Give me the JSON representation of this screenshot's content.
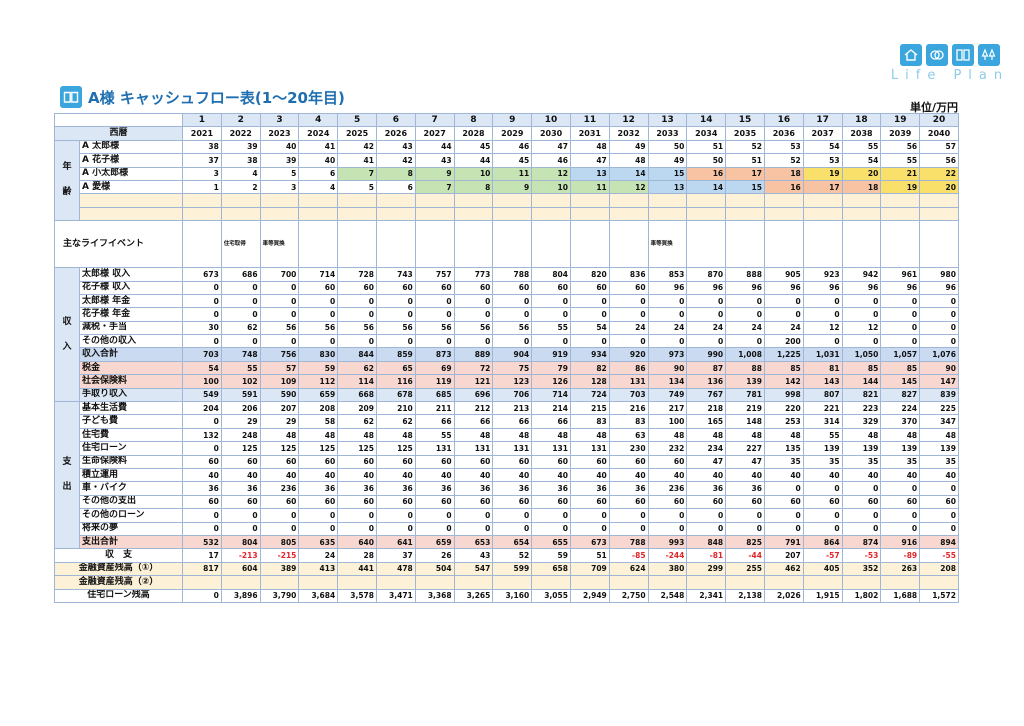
{
  "brand": {
    "text": "Life Plan"
  },
  "title": "A様 キャッシュフロー表(1〜20年目)",
  "unit": "単位/万円",
  "years_index": [
    "1",
    "2",
    "3",
    "4",
    "5",
    "6",
    "7",
    "8",
    "9",
    "10",
    "11",
    "12",
    "13",
    "14",
    "15",
    "16",
    "17",
    "18",
    "19",
    "20"
  ],
  "header_label": "西暦",
  "years": [
    "2021",
    "2022",
    "2023",
    "2024",
    "2025",
    "2026",
    "2027",
    "2028",
    "2029",
    "2030",
    "2031",
    "2032",
    "2033",
    "2034",
    "2035",
    "2036",
    "2037",
    "2038",
    "2039",
    "2040"
  ],
  "age_side": [
    "年",
    "齢"
  ],
  "ages": [
    {
      "label": "A 太郎様",
      "values": [
        "38",
        "39",
        "40",
        "41",
        "42",
        "43",
        "44",
        "45",
        "46",
        "47",
        "48",
        "49",
        "50",
        "51",
        "52",
        "53",
        "54",
        "55",
        "56",
        "57"
      ]
    },
    {
      "label": "A 花子様",
      "values": [
        "37",
        "38",
        "39",
        "40",
        "41",
        "42",
        "43",
        "44",
        "45",
        "46",
        "47",
        "48",
        "49",
        "50",
        "51",
        "52",
        "53",
        "54",
        "55",
        "56"
      ]
    },
    {
      "label": "A 小太郎様",
      "values": [
        "3",
        "4",
        "5",
        "6",
        "7",
        "8",
        "9",
        "10",
        "11",
        "12",
        "13",
        "14",
        "15",
        "16",
        "17",
        "18",
        "19",
        "20",
        "21",
        "22"
      ]
    },
    {
      "label": "A 愛様",
      "values": [
        "1",
        "2",
        "3",
        "4",
        "5",
        "6",
        "7",
        "8",
        "9",
        "10",
        "11",
        "12",
        "13",
        "14",
        "15",
        "16",
        "17",
        "18",
        "19",
        "20"
      ]
    }
  ],
  "life_event_label": "主なライフイベント",
  "life_events": [
    "",
    "住宅取得",
    "車等買換",
    "",
    "",
    "",
    "",
    "",
    "",
    "",
    "",
    "",
    "車等買換",
    "",
    "",
    "",
    "",
    "",
    "",
    ""
  ],
  "income_side": [
    "収",
    "入"
  ],
  "income": [
    {
      "label": "太郎様 収入",
      "values": [
        "673",
        "686",
        "700",
        "714",
        "728",
        "743",
        "757",
        "773",
        "788",
        "804",
        "820",
        "836",
        "853",
        "870",
        "888",
        "905",
        "923",
        "942",
        "961",
        "980"
      ]
    },
    {
      "label": "花子様 収入",
      "values": [
        "0",
        "0",
        "0",
        "60",
        "60",
        "60",
        "60",
        "60",
        "60",
        "60",
        "60",
        "60",
        "96",
        "96",
        "96",
        "96",
        "96",
        "96",
        "96",
        "96"
      ]
    },
    {
      "label": "太郎様 年金",
      "values": [
        "0",
        "0",
        "0",
        "0",
        "0",
        "0",
        "0",
        "0",
        "0",
        "0",
        "0",
        "0",
        "0",
        "0",
        "0",
        "0",
        "0",
        "0",
        "0",
        "0"
      ]
    },
    {
      "label": "花子様 年金",
      "values": [
        "0",
        "0",
        "0",
        "0",
        "0",
        "0",
        "0",
        "0",
        "0",
        "0",
        "0",
        "0",
        "0",
        "0",
        "0",
        "0",
        "0",
        "0",
        "0",
        "0"
      ]
    },
    {
      "label": "減税・手当",
      "values": [
        "30",
        "62",
        "56",
        "56",
        "56",
        "56",
        "56",
        "56",
        "56",
        "55",
        "54",
        "24",
        "24",
        "24",
        "24",
        "24",
        "12",
        "12",
        "0",
        "0"
      ]
    },
    {
      "label": "その他の収入",
      "values": [
        "0",
        "0",
        "0",
        "0",
        "0",
        "0",
        "0",
        "0",
        "0",
        "0",
        "0",
        "0",
        "0",
        "0",
        "0",
        "200",
        "0",
        "0",
        "0",
        "0"
      ]
    }
  ],
  "income_total": {
    "label": "収入合計",
    "values": [
      "703",
      "748",
      "756",
      "830",
      "844",
      "859",
      "873",
      "889",
      "904",
      "919",
      "934",
      "920",
      "973",
      "990",
      "1,008",
      "1,225",
      "1,031",
      "1,050",
      "1,057",
      "1,076"
    ]
  },
  "tax": {
    "label": "税金",
    "values": [
      "54",
      "55",
      "57",
      "59",
      "62",
      "65",
      "69",
      "72",
      "75",
      "79",
      "82",
      "86",
      "90",
      "87",
      "88",
      "85",
      "81",
      "85",
      "85",
      "90"
    ]
  },
  "social": {
    "label": "社会保険料",
    "values": [
      "100",
      "102",
      "109",
      "112",
      "114",
      "116",
      "119",
      "121",
      "123",
      "126",
      "128",
      "131",
      "134",
      "136",
      "139",
      "142",
      "143",
      "144",
      "145",
      "147"
    ]
  },
  "takehome": {
    "label": "手取り収入",
    "values": [
      "549",
      "591",
      "590",
      "659",
      "668",
      "678",
      "685",
      "696",
      "706",
      "714",
      "724",
      "703",
      "749",
      "767",
      "781",
      "998",
      "807",
      "821",
      "827",
      "839"
    ]
  },
  "expense_side": [
    "支",
    "出"
  ],
  "expenses": [
    {
      "label": "基本生活費",
      "values": [
        "204",
        "206",
        "207",
        "208",
        "209",
        "210",
        "211",
        "212",
        "213",
        "214",
        "215",
        "216",
        "217",
        "218",
        "219",
        "220",
        "221",
        "223",
        "224",
        "225"
      ]
    },
    {
      "label": "子ども費",
      "values": [
        "0",
        "29",
        "29",
        "58",
        "62",
        "62",
        "66",
        "66",
        "66",
        "66",
        "83",
        "83",
        "100",
        "165",
        "148",
        "253",
        "314",
        "329",
        "370",
        "347"
      ]
    },
    {
      "label": "住宅費",
      "values": [
        "132",
        "248",
        "48",
        "48",
        "48",
        "48",
        "55",
        "48",
        "48",
        "48",
        "48",
        "63",
        "48",
        "48",
        "48",
        "48",
        "55",
        "48",
        "48",
        "48"
      ]
    },
    {
      "label": "住宅ローン",
      "values": [
        "0",
        "125",
        "125",
        "125",
        "125",
        "125",
        "131",
        "131",
        "131",
        "131",
        "131",
        "230",
        "232",
        "234",
        "227",
        "135",
        "139",
        "139",
        "139",
        "139"
      ]
    },
    {
      "label": "生命保険料",
      "values": [
        "60",
        "60",
        "60",
        "60",
        "60",
        "60",
        "60",
        "60",
        "60",
        "60",
        "60",
        "60",
        "60",
        "47",
        "47",
        "35",
        "35",
        "35",
        "35",
        "35"
      ]
    },
    {
      "label": "積立運用",
      "values": [
        "40",
        "40",
        "40",
        "40",
        "40",
        "40",
        "40",
        "40",
        "40",
        "40",
        "40",
        "40",
        "40",
        "40",
        "40",
        "40",
        "40",
        "40",
        "40",
        "40"
      ]
    },
    {
      "label": "車・バイク",
      "values": [
        "36",
        "36",
        "236",
        "36",
        "36",
        "36",
        "36",
        "36",
        "36",
        "36",
        "36",
        "36",
        "236",
        "36",
        "36",
        "0",
        "0",
        "0",
        "0",
        "0"
      ]
    },
    {
      "label": "その他の支出",
      "values": [
        "60",
        "60",
        "60",
        "60",
        "60",
        "60",
        "60",
        "60",
        "60",
        "60",
        "60",
        "60",
        "60",
        "60",
        "60",
        "60",
        "60",
        "60",
        "60",
        "60"
      ]
    },
    {
      "label": "その他のローン",
      "values": [
        "0",
        "0",
        "0",
        "0",
        "0",
        "0",
        "0",
        "0",
        "0",
        "0",
        "0",
        "0",
        "0",
        "0",
        "0",
        "0",
        "0",
        "0",
        "0",
        "0"
      ]
    },
    {
      "label": "将来の夢",
      "values": [
        "0",
        "0",
        "0",
        "0",
        "0",
        "0",
        "0",
        "0",
        "0",
        "0",
        "0",
        "0",
        "0",
        "0",
        "0",
        "0",
        "0",
        "0",
        "0",
        "0"
      ]
    }
  ],
  "expense_total": {
    "label": "支出合計",
    "values": [
      "532",
      "804",
      "805",
      "635",
      "640",
      "641",
      "659",
      "653",
      "654",
      "655",
      "673",
      "788",
      "993",
      "848",
      "825",
      "791",
      "864",
      "874",
      "916",
      "894"
    ]
  },
  "balance": {
    "label": "収　支",
    "values": [
      "17",
      "-213",
      "-215",
      "24",
      "28",
      "37",
      "26",
      "43",
      "52",
      "59",
      "51",
      "-85",
      "-244",
      "-81",
      "-44",
      "207",
      "-57",
      "-53",
      "-89",
      "-55"
    ]
  },
  "assets1": {
    "label": "金融資産残高（①）",
    "values": [
      "817",
      "604",
      "389",
      "413",
      "441",
      "478",
      "504",
      "547",
      "599",
      "658",
      "709",
      "624",
      "380",
      "299",
      "255",
      "462",
      "405",
      "352",
      "263",
      "208"
    ]
  },
  "assets2": {
    "label": "金融資産残高（②）",
    "values": [
      "",
      "",
      "",
      "",
      "",
      "",
      "",
      "",
      "",
      "",
      "",
      "",
      "",
      "",
      "",
      "",
      "",
      "",
      "",
      ""
    ]
  },
  "loan_balance": {
    "label": "住宅ローン残高",
    "values": [
      "0",
      "3,896",
      "3,790",
      "3,684",
      "3,578",
      "3,471",
      "3,368",
      "3,265",
      "3,160",
      "3,055",
      "2,949",
      "2,750",
      "2,548",
      "2,341",
      "2,138",
      "2,026",
      "1,915",
      "1,802",
      "1,688",
      "1,572"
    ]
  },
  "age_colors": {
    "child1": [
      "",
      "",
      "",
      "",
      "g",
      "g",
      "g",
      "g",
      "g",
      "g",
      "b",
      "b",
      "b",
      "o",
      "o",
      "o",
      "y",
      "y",
      "y",
      "y"
    ],
    "child2": [
      "",
      "",
      "",
      "",
      "",
      "",
      "g",
      "g",
      "g",
      "g",
      "g",
      "g",
      "b",
      "b",
      "b",
      "o",
      "o",
      "o",
      "y",
      "y"
    ]
  }
}
